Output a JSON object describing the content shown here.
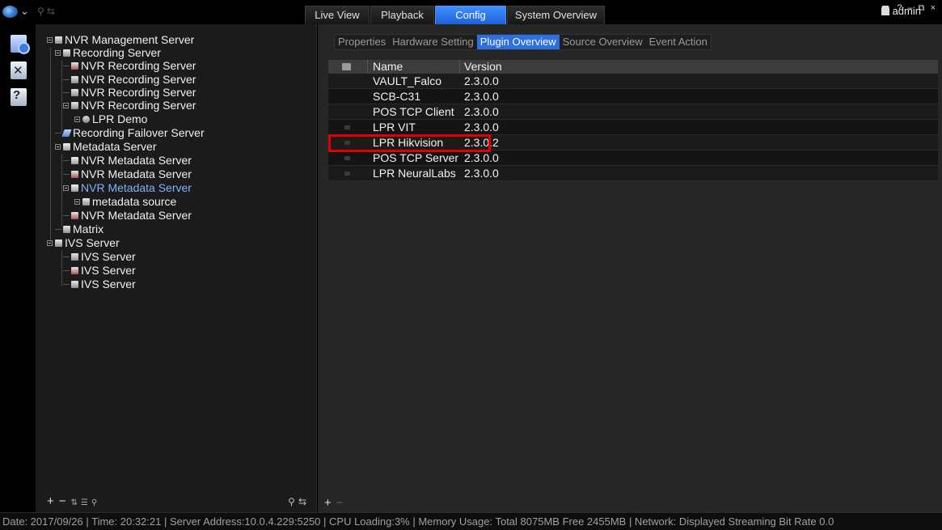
{
  "topbar": {
    "tabs": [
      {
        "label": "Live View",
        "active": false
      },
      {
        "label": "Playback",
        "active": false
      },
      {
        "label": "Config",
        "active": true
      },
      {
        "label": "System Overview",
        "active": false
      }
    ],
    "user": "admin",
    "window_controls": "? – ⧉ ×"
  },
  "tree": [
    {
      "label": "NVR Management Server",
      "icon": "management-server-icon"
    },
    {
      "label": "Recording Server",
      "icon": "recording-server-icon"
    },
    {
      "label": "NVR Recording Server",
      "icon": "recording-server-icon"
    },
    {
      "label": "NVR Recording Server",
      "icon": "recording-server-icon"
    },
    {
      "label": "NVR Recording Server",
      "icon": "recording-server-icon"
    },
    {
      "label": "NVR Recording Server",
      "icon": "recording-server-icon"
    },
    {
      "label": "LPR Demo",
      "icon": "lpr-icon"
    },
    {
      "label": "Recording Failover Server",
      "icon": "failover-icon"
    },
    {
      "label": "Metadata Server",
      "icon": "metadata-server-icon"
    },
    {
      "label": "NVR Metadata Server",
      "icon": "metadata-server-icon"
    },
    {
      "label": "NVR Metadata Server",
      "icon": "metadata-server-icon"
    },
    {
      "label": "NVR Metadata Server",
      "icon": "metadata-server-icon",
      "selected": true
    },
    {
      "label": "metadata source",
      "icon": "metadata-source-icon"
    },
    {
      "label": "NVR Metadata Server",
      "icon": "metadata-server-icon"
    },
    {
      "label": "Matrix",
      "icon": "matrix-icon"
    },
    {
      "label": "IVS Server",
      "icon": "ivs-server-icon"
    },
    {
      "label": "IVS Server",
      "icon": "ivs-server-icon"
    },
    {
      "label": "IVS Server",
      "icon": "ivs-server-icon"
    },
    {
      "label": "IVS Server",
      "icon": "ivs-server-icon"
    }
  ],
  "subtabs": [
    {
      "label": "Properties",
      "active": false
    },
    {
      "label": "Hardware Setting",
      "active": false
    },
    {
      "label": "Plugin Overview",
      "active": true
    },
    {
      "label": "Source Overview",
      "active": false
    },
    {
      "label": "Event Action",
      "active": false
    }
  ],
  "grid": {
    "columns": [
      "Name",
      "Version"
    ],
    "rows": [
      {
        "name": "VAULT_Falco",
        "version": "2.3.0.0"
      },
      {
        "name": "SCB-C31",
        "version": "2.3.0.0"
      },
      {
        "name": "POS TCP Client",
        "version": "2.3.0.0"
      },
      {
        "name": "LPR VIT",
        "version": "2.3.0.0"
      },
      {
        "name": "LPR Hikvision",
        "version": "2.3.0.2",
        "highlighted": true
      },
      {
        "name": "POS TCP Server",
        "version": "2.3.0.0"
      },
      {
        "name": "LPR NeuralLabs",
        "version": "2.3.0.0"
      }
    ]
  },
  "status": "Date: 2017/09/26  |  Time: 20:32:21  |  Server Address:10.0.4.229:5250  |  CPU Loading:3%  |  Memory Usage: Total 8075MB  Free 2455MB  |  Network: Displayed Streaming Bit Rate  0.0",
  "colors": {
    "accent": "#2c6fe0",
    "highlight": "#e10000",
    "selected_text": "#7fb2ff"
  }
}
